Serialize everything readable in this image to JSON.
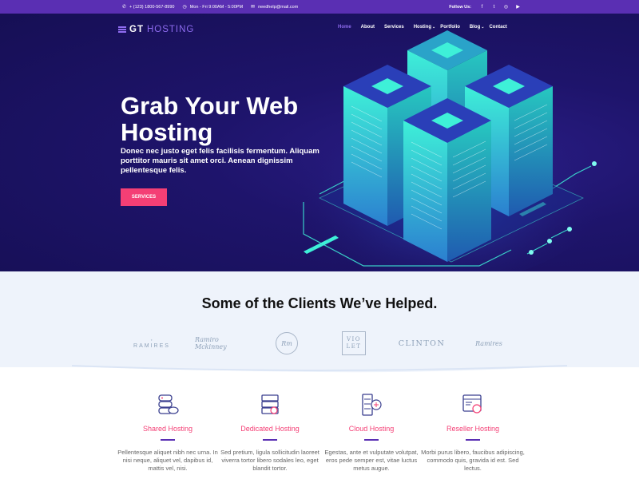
{
  "topbar": {
    "phone": "+ (123) 1800-567-8990",
    "hours": "Mon - Fri 9:00AM - 5:00PM",
    "email": "needhelp@mail.com",
    "follow_label": "Follow Us:"
  },
  "brand": {
    "bold": "GT",
    "light": "HOSTING"
  },
  "nav": {
    "home": "Home",
    "about": "About",
    "services": "Services",
    "hosting": "Hosting",
    "portfolio": "Portfolio",
    "blog": "Blog",
    "contact": "Contact"
  },
  "hero": {
    "title": "Grab Your Web Hosting",
    "description": "Donec nec justo eget felis facilisis fermentum. Aliquam porttitor mauris sit amet orci. Aenean dignissim pellentesque felis.",
    "cta": "SERVICES"
  },
  "clients": {
    "heading": "Some of the Clients We’ve Helped.",
    "logos": {
      "ramires": "RAMIRES",
      "mckinney": "Ramiro Mckinney",
      "circle": "Rm",
      "violet_top": "VIO",
      "violet_bottom": "LET",
      "clinton": "CLINTON",
      "ramires2": "Ramires"
    }
  },
  "services": [
    {
      "title": "Shared Hosting",
      "text": "Pellentesque aliquet nibh nec urna. In nisi neque, aliquet vel, dapibus id, mattis vel, nisi."
    },
    {
      "title": "Dedicated Hosting",
      "text": "Sed pretium, ligula sollicitudin laoreet viverra tortor libero sodales leo, eget blandit tortor."
    },
    {
      "title": "Cloud Hosting",
      "text": "Egestas, ante et vulputate volutpat, eros pede semper est, vitae luctus metus augue."
    },
    {
      "title": "Reseller Hosting",
      "text": "Morbi purus libero, faucibus adipiscing, commodo quis, gravida id est. Sed lectus."
    }
  ],
  "colors": {
    "topbar": "#5a2fb3",
    "hero_bg": "#1e146b",
    "accent_pink": "#f43f75",
    "accent_purple": "#8f6cf0",
    "server_teal": "#3ef0d8",
    "clients_bg": "#eef3fb"
  },
  "icons": {
    "phone": "phone-icon",
    "clock": "clock-icon",
    "mail": "mail-icon",
    "social": [
      "facebook-icon",
      "twitter-icon",
      "instagram-icon",
      "youtube-icon"
    ],
    "services": [
      "shared-server-icon",
      "dedicated-server-icon",
      "cloud-server-icon",
      "reseller-browser-icon"
    ]
  }
}
